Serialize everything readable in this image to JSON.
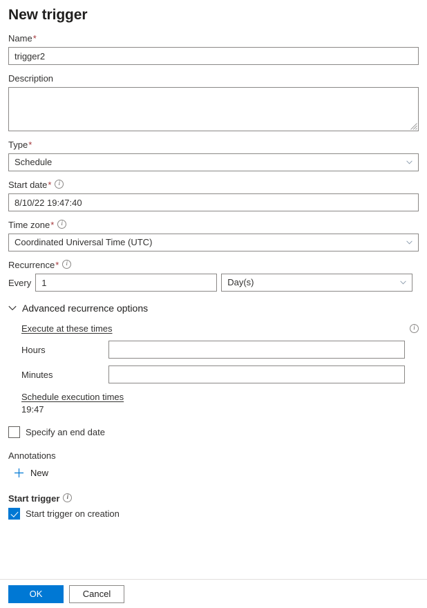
{
  "page": {
    "title": "New trigger"
  },
  "fields": {
    "name": {
      "label": "Name",
      "required_marker": "*",
      "value": "trigger2"
    },
    "description": {
      "label": "Description",
      "value": ""
    },
    "type": {
      "label": "Type",
      "required_marker": "*",
      "value": "Schedule"
    },
    "start_date": {
      "label": "Start date",
      "required_marker": "*",
      "value": "8/10/22 19:47:40"
    },
    "time_zone": {
      "label": "Time zone",
      "required_marker": "*",
      "value": "Coordinated Universal Time (UTC)"
    },
    "recurrence": {
      "label": "Recurrence",
      "required_marker": "*",
      "every_label": "Every",
      "every_value": "1",
      "unit_value": "Day(s)"
    }
  },
  "advanced": {
    "toggle_label": "Advanced recurrence options",
    "execute_heading": "Execute at these times",
    "hours_label": "Hours",
    "hours_value": "",
    "minutes_label": "Minutes",
    "minutes_value": "",
    "schedule_heading": "Schedule execution times",
    "schedule_value": "19:47",
    "end_date_checkbox_label": "Specify an end date"
  },
  "annotations": {
    "label": "Annotations",
    "new_label": "New"
  },
  "start_trigger": {
    "label": "Start trigger",
    "checkbox_label": "Start trigger on creation"
  },
  "footer": {
    "ok_label": "OK",
    "cancel_label": "Cancel"
  }
}
